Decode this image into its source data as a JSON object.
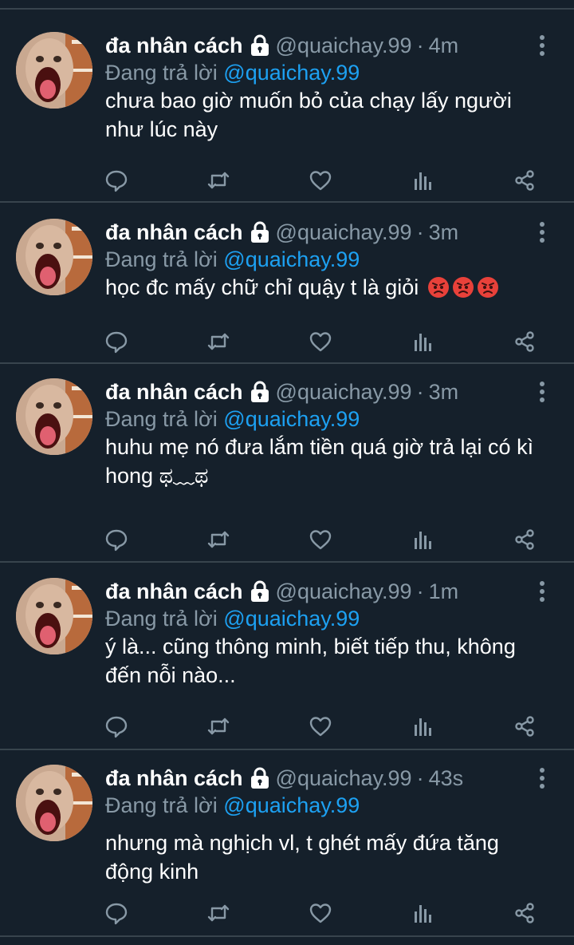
{
  "tweets": [
    {
      "name": "đa nhân cách",
      "handle": "@quaichay.99",
      "separator": "·",
      "time": "4m",
      "replying_prefix": "Đang trả lời",
      "replying_to": "@quaichay.99",
      "text": "chưa bao giờ muốn bỏ của chạy lấy người như lúc này",
      "emoji_count": 0
    },
    {
      "name": "đa nhân cách",
      "handle": "@quaichay.99",
      "separator": "·",
      "time": "3m",
      "replying_prefix": "Đang trả lời",
      "replying_to": "@quaichay.99",
      "text": "học đc mấy chữ chỉ quậy t là giỏi",
      "emoji_count": 3,
      "emoji": "pouting-face"
    },
    {
      "name": "đa nhân cách",
      "handle": "@quaichay.99",
      "separator": "·",
      "time": "3m",
      "replying_prefix": "Đang trả lời",
      "replying_to": "@quaichay.99",
      "text": "huhu mẹ nó đưa lắm tiền quá giờ trả lại có kì hong ಥ﹏ಥ",
      "emoji_count": 0
    },
    {
      "name": "đa nhân cách",
      "handle": "@quaichay.99",
      "separator": "·",
      "time": "1m",
      "replying_prefix": "Đang trả lời",
      "replying_to": "@quaichay.99",
      "text": "ý là... cũng thông minh, biết tiếp thu, không đến nỗi nào...",
      "emoji_count": 0
    },
    {
      "name": "đa nhân cách",
      "handle": "@quaichay.99",
      "separator": "·",
      "time": "43s",
      "replying_prefix": "Đang trả lời",
      "replying_to": "@quaichay.99",
      "text": "nhưng mà nghịch vl, t ghét mấy đứa tăng động kinh",
      "emoji_count": 0
    }
  ],
  "icons": [
    "lock-icon",
    "more-icon",
    "reply-icon",
    "retweet-icon",
    "like-icon",
    "analytics-icon",
    "share-icon"
  ],
  "colors": {
    "background": "#15202b",
    "divider": "#38444d",
    "secondary_text": "#8899a6",
    "mention": "#1da1f2",
    "primary_text": "#ffffff"
  }
}
